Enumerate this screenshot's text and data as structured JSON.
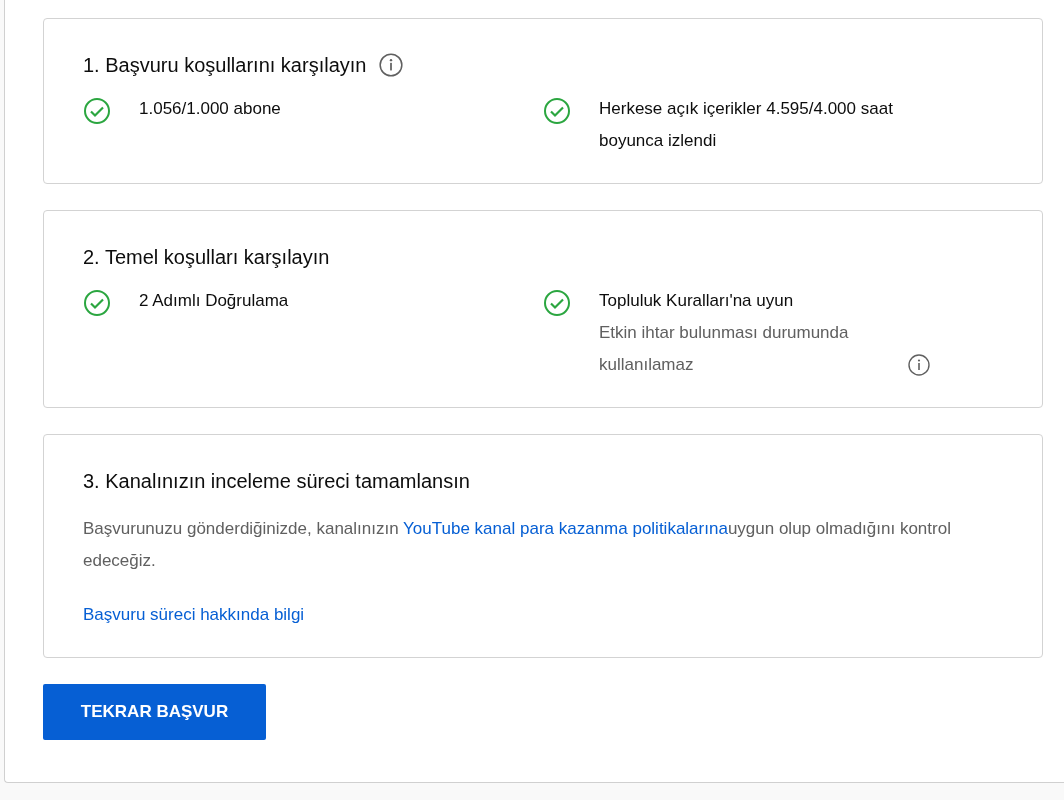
{
  "sections": [
    {
      "title": "1. Başvuru koşullarını karşılayın",
      "info": true,
      "items": [
        {
          "met": true,
          "title": "1.056/1.000 abone"
        },
        {
          "met": true,
          "title": "Herkese açık içerikler 4.595/4.000 saat boyunca izlendi"
        }
      ]
    },
    {
      "title": "2. Temel koşulları karşılayın",
      "info": false,
      "items": [
        {
          "met": true,
          "title": "2 Adımlı Doğrulama"
        },
        {
          "met": true,
          "title": "Topluluk Kuralları'na uyun",
          "description": "Etkin ihtar bulunması durumunda kullanılamaz",
          "description_info": true
        }
      ]
    },
    {
      "title": "3. Kanalınızın inceleme süreci tamamlansın",
      "info": false,
      "body": {
        "before": "Başvurunuzu gönderdiğinizde, kanalınızın ",
        "link": "YouTube kanal para kazanma politikalarına",
        "after": "uygun olup olmadığını kontrol edeceğiz."
      },
      "help_link": "Başvuru süreci hakkında bilgi"
    }
  ],
  "button": "TEKRAR BAŞVUR"
}
